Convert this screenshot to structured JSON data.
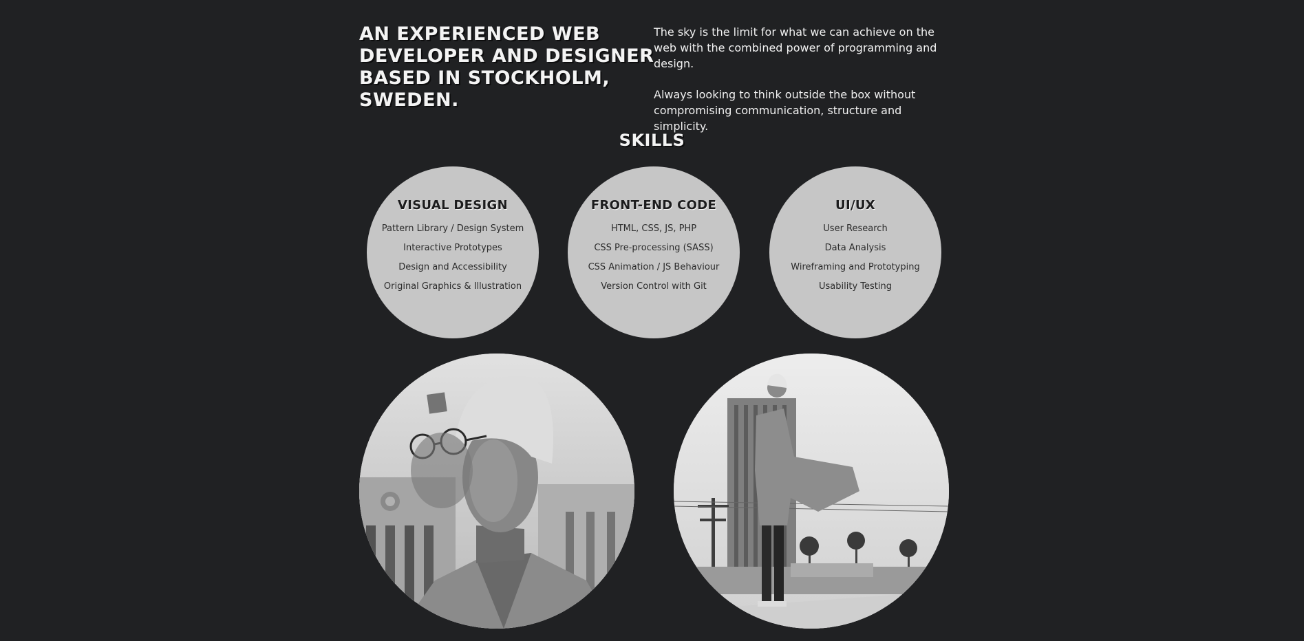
{
  "intro": {
    "title": "AN EXPERIENCED WEB DEVELOPER AND DESIGNER BASED IN STOCKHOLM, SWEDEN.",
    "paragraph_1": "The sky is the limit for what we can achieve on the web with the combined power of programming and design.",
    "paragraph_2": "Always looking to think outside the box without compromising communication, structure and simplicity."
  },
  "skills": {
    "heading": "SKILLS",
    "groups": [
      {
        "title": "VISUAL DESIGN",
        "items": [
          "Pattern Library / Design System",
          "Interactive Prototypes",
          "Design and Accessibility",
          "Original Graphics & Illustration"
        ]
      },
      {
        "title": "FRONT-END CODE",
        "items": [
          "HTML, CSS, JS, PHP",
          "CSS Pre-processing (SASS)",
          "CSS Animation / JS Behaviour",
          "Version Control with Git"
        ]
      },
      {
        "title": "UI/UX",
        "items": [
          "User Research",
          "Data Analysis",
          "Wireframing and Prototyping",
          "Usability Testing"
        ]
      }
    ]
  },
  "photos": [
    {
      "icon": "portrait-photo"
    },
    {
      "icon": "city-standing-photo"
    }
  ],
  "colors": {
    "background": "#202123",
    "circle": "#c6c6c6",
    "heading": "#f4f4f4",
    "body_text": "#f1f1f1"
  }
}
